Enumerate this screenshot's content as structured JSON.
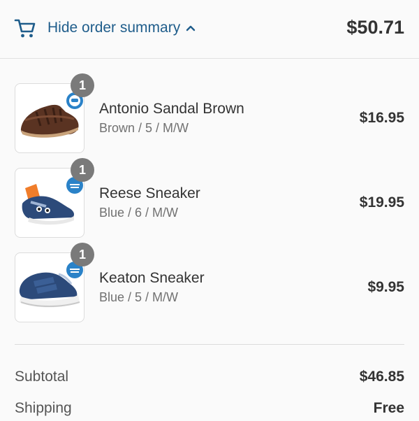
{
  "header": {
    "toggle_label": "Hide order summary",
    "total": "$50.71",
    "icons": [
      "cart-icon",
      "chevron-up-icon"
    ],
    "accent_color": "#1f5d8b"
  },
  "items": [
    {
      "quantity": "1",
      "name": "Antonio Sandal Brown",
      "variant": "Brown / 5 / M/W",
      "price": "$16.95",
      "image": "brown-sandal-image"
    },
    {
      "quantity": "1",
      "name": "Reese Sneaker",
      "variant": "Blue / 6 / M/W",
      "price": "$19.95",
      "image": "blue-sneaker-orange-tongue-image"
    },
    {
      "quantity": "1",
      "name": "Keaton Sneaker",
      "variant": "Blue / 5 / M/W",
      "price": "$9.95",
      "image": "blue-velcro-sneaker-image"
    }
  ],
  "summary": {
    "subtotal_label": "Subtotal",
    "subtotal_value": "$46.85",
    "shipping_label": "Shipping",
    "shipping_value": "Free"
  }
}
